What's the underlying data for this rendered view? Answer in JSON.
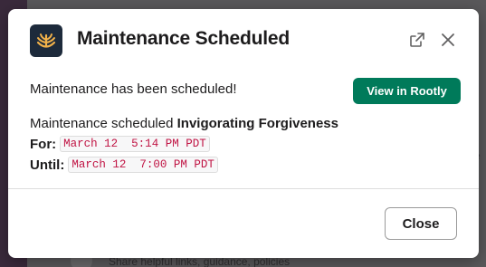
{
  "background": {
    "hint_text": "Share helpful links, guidance, policies"
  },
  "modal": {
    "title": "Maintenance Scheduled",
    "app_icon": "rootly-logo-icon",
    "external_link_icon": "external-link-icon",
    "close_icon": "close-icon",
    "message": "Maintenance has been scheduled!",
    "view_button_label": "View in Rootly",
    "scheduled_prefix": "Maintenance scheduled",
    "maintenance_name": "Invigorating Forgiveness",
    "for_label": "For:",
    "for_value": "March 12  5:14 PM PDT",
    "until_label": "Until:",
    "until_value": "March 12  7:00 PM PDT",
    "close_button_label": "Close"
  },
  "colors": {
    "primary_button": "#007a5a",
    "code_text": "#c01343",
    "icon_background": "#1d2a3b",
    "icon_accent": "#f2b24a"
  }
}
